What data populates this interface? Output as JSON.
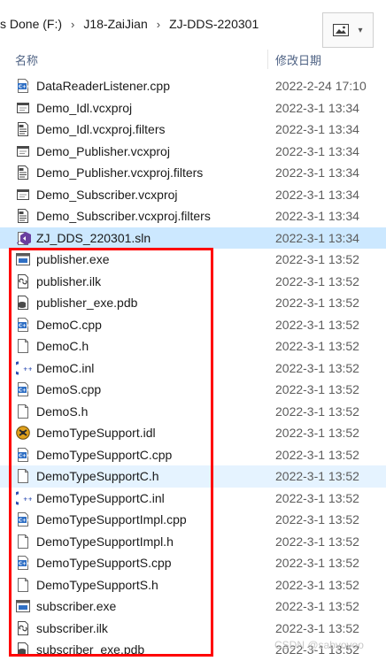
{
  "breadcrumbs": [
    "s Done (F:)",
    "J18-ZaiJian",
    "ZJ-DDS-220301"
  ],
  "breadcrumb_separator": "›",
  "view_button": {
    "icon": "picture-view-icon",
    "chevron": "▾"
  },
  "columns": {
    "name": "名称",
    "date": "修改日期"
  },
  "files": [
    {
      "name": "DataReaderListener.cpp",
      "date": "2022-2-24 17:10",
      "icon": "cpp"
    },
    {
      "name": "Demo_Idl.vcxproj",
      "date": "2022-3-1 13:34",
      "icon": "vcxproj"
    },
    {
      "name": "Demo_Idl.vcxproj.filters",
      "date": "2022-3-1 13:34",
      "icon": "filters"
    },
    {
      "name": "Demo_Publisher.vcxproj",
      "date": "2022-3-1 13:34",
      "icon": "vcxproj"
    },
    {
      "name": "Demo_Publisher.vcxproj.filters",
      "date": "2022-3-1 13:34",
      "icon": "filters"
    },
    {
      "name": "Demo_Subscriber.vcxproj",
      "date": "2022-3-1 13:34",
      "icon": "vcxproj"
    },
    {
      "name": "Demo_Subscriber.vcxproj.filters",
      "date": "2022-3-1 13:34",
      "icon": "filters"
    },
    {
      "name": "ZJ_DDS_220301.sln",
      "date": "2022-3-1 13:34",
      "icon": "sln",
      "state": "selected"
    },
    {
      "name": "publisher.exe",
      "date": "2022-3-1 13:52",
      "icon": "exe"
    },
    {
      "name": "publisher.ilk",
      "date": "2022-3-1 13:52",
      "icon": "ilk"
    },
    {
      "name": "publisher_exe.pdb",
      "date": "2022-3-1 13:52",
      "icon": "pdb"
    },
    {
      "name": "DemoC.cpp",
      "date": "2022-3-1 13:52",
      "icon": "cpp"
    },
    {
      "name": "DemoC.h",
      "date": "2022-3-1 13:52",
      "icon": "h"
    },
    {
      "name": "DemoC.inl",
      "date": "2022-3-1 13:52",
      "icon": "inl"
    },
    {
      "name": "DemoS.cpp",
      "date": "2022-3-1 13:52",
      "icon": "cpp"
    },
    {
      "name": "DemoS.h",
      "date": "2022-3-1 13:52",
      "icon": "h"
    },
    {
      "name": "DemoTypeSupport.idl",
      "date": "2022-3-1 13:52",
      "icon": "idl"
    },
    {
      "name": "DemoTypeSupportC.cpp",
      "date": "2022-3-1 13:52",
      "icon": "cpp"
    },
    {
      "name": "DemoTypeSupportC.h",
      "date": "2022-3-1 13:52",
      "icon": "h",
      "state": "hover"
    },
    {
      "name": "DemoTypeSupportC.inl",
      "date": "2022-3-1 13:52",
      "icon": "inl"
    },
    {
      "name": "DemoTypeSupportImpl.cpp",
      "date": "2022-3-1 13:52",
      "icon": "cpp"
    },
    {
      "name": "DemoTypeSupportImpl.h",
      "date": "2022-3-1 13:52",
      "icon": "h"
    },
    {
      "name": "DemoTypeSupportS.cpp",
      "date": "2022-3-1 13:52",
      "icon": "cpp"
    },
    {
      "name": "DemoTypeSupportS.h",
      "date": "2022-3-1 13:52",
      "icon": "h"
    },
    {
      "name": "subscriber.exe",
      "date": "2022-3-1 13:52",
      "icon": "exe"
    },
    {
      "name": "subscriber.ilk",
      "date": "2022-3-1 13:52",
      "icon": "ilk"
    },
    {
      "name": "subscriber_exe.pdb",
      "date": "2022-3-1 13:52",
      "icon": "pdb"
    }
  ],
  "highlight_color": "#ff0000",
  "selection_color": "#cce8ff",
  "hover_color": "#e5f3ff",
  "watermark": "CSDN @sabyoyoo"
}
